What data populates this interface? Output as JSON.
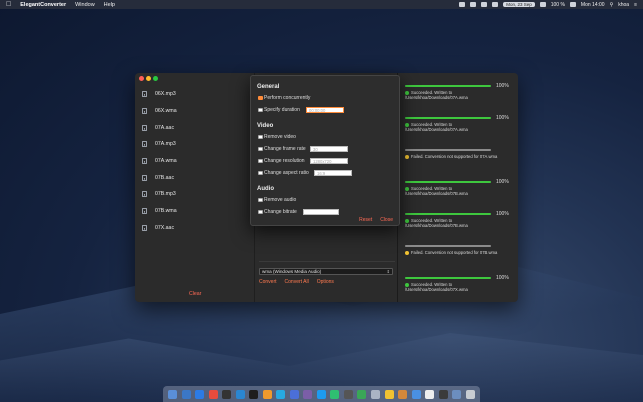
{
  "menubar": {
    "app_name": "ElegantConverter",
    "menus": [
      "Window",
      "Help"
    ],
    "date": "Mon, 23 Sep",
    "time": "Mon 14:00",
    "battery": "100 %",
    "user": "khoa"
  },
  "files": [
    "06X.mp3",
    "06X.wma",
    "07A.aac",
    "07A.mp3",
    "07A.wma",
    "07B.aac",
    "07B.mp3",
    "07B.wma",
    "07X.aac"
  ],
  "sidebar": {
    "clear_label": "Clear"
  },
  "format": {
    "selected": "wma (Windows Media Audio)"
  },
  "actions": {
    "convert": "Convert",
    "convert_all": "Convert All",
    "options": "Options"
  },
  "options": {
    "general_title": "General",
    "perform_concurrently": "Perform concurrently",
    "specify_duration": "Specify duration",
    "duration_placeholder": "00:00:00",
    "video_title": "Video",
    "remove_video": "Remove video",
    "change_frame_rate": "Change frame rate",
    "frame_rate_placeholder": "30",
    "change_resolution": "Change resolution",
    "resolution_placeholder": "1280x720",
    "change_aspect_ratio": "Change aspect ratio",
    "aspect_placeholder": "16:9",
    "audio_title": "Audio",
    "remove_audio": "Remove audio",
    "change_bitrate": "Change bitrate",
    "reset_label": "Reset",
    "close_label": "Close"
  },
  "results": [
    {
      "progress": 1.0,
      "pct": "100%",
      "status": "ok",
      "message": "Succeeded. Written to /Users/khoa/Downloads/07A.wma"
    },
    {
      "progress": 1.0,
      "pct": "100%",
      "status": "ok",
      "message": "Succeeded. Written to /Users/khoa/Downloads/07A.wma"
    },
    {
      "progress": 1.0,
      "pct": "",
      "status": "fail",
      "message": "Failed. Conversion not supported for 07A.wma"
    },
    {
      "progress": 1.0,
      "pct": "100%",
      "status": "ok",
      "message": "Succeeded. Written to /Users/khoa/Downloads/07B.wma"
    },
    {
      "progress": 1.0,
      "pct": "100%",
      "status": "ok",
      "message": "Succeeded. Written to /Users/khoa/Downloads/07B.wma"
    },
    {
      "progress": 1.0,
      "pct": "",
      "status": "fail",
      "message": "Failed. Conversion not supported for 07B.wma"
    },
    {
      "progress": 1.0,
      "pct": "100%",
      "status": "ok",
      "message": "Succeeded. Written to /Users/khoa/Downloads/07X.wma"
    }
  ]
}
